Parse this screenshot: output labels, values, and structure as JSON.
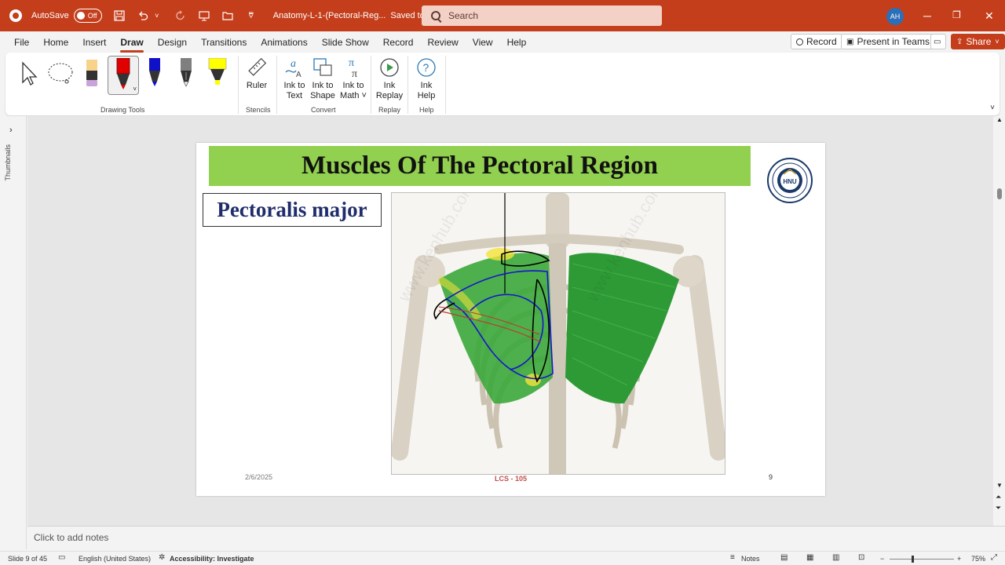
{
  "titlebar": {
    "autosave_label": "AutoSave",
    "autosave_state": "Off",
    "document_title": "Anatomy-L-1-(Pectoral-Reg...",
    "save_status": "Saved to this PC",
    "search_placeholder": "Search",
    "user_initials": "AH"
  },
  "menu": {
    "tabs": [
      "File",
      "Home",
      "Insert",
      "Draw",
      "Design",
      "Transitions",
      "Animations",
      "Slide Show",
      "Record",
      "Review",
      "View",
      "Help"
    ],
    "active_tab": "Draw",
    "record_button": "Record",
    "present_button": "Present in Teams",
    "share_button": "Share"
  },
  "ribbon": {
    "groups": {
      "drawing_tools": "Drawing Tools",
      "stencils": "Stencils",
      "convert": "Convert",
      "replay": "Replay",
      "help": "Help"
    },
    "buttons": {
      "ruler": "Ruler",
      "ink_to_text_1": "Ink to",
      "ink_to_text_2": "Text",
      "ink_to_shape_1": "Ink to",
      "ink_to_shape_2": "Shape",
      "ink_to_math_1": "Ink to",
      "ink_to_math_2": "Math ˅",
      "ink_replay_1": "Ink",
      "ink_replay_2": "Replay",
      "ink_help_1": "Ink",
      "ink_help_2": "Help"
    },
    "pen_colors": {
      "highlighter_lavender": "#c9a3d9",
      "pen_red": "#e00000",
      "pen_blue": "#1010c8",
      "pencil_gray": "#7f7f7f",
      "highlighter_yellow": "#ffff00"
    }
  },
  "thumbnails": {
    "label": "Thumbnails"
  },
  "slide": {
    "title": "Muscles Of The Pectoral Region",
    "subtitle": "Pectoralis major",
    "date": "2/6/2025",
    "course": "LCS - 105",
    "number": "9",
    "title_bar_color": "#92d050"
  },
  "notes": {
    "placeholder": "Click to add notes"
  },
  "status": {
    "slide_info": "Slide 9 of 45",
    "language": "English (United States)",
    "accessibility": "Accessibility: Investigate",
    "notes_button": "Notes",
    "zoom": "75%"
  }
}
